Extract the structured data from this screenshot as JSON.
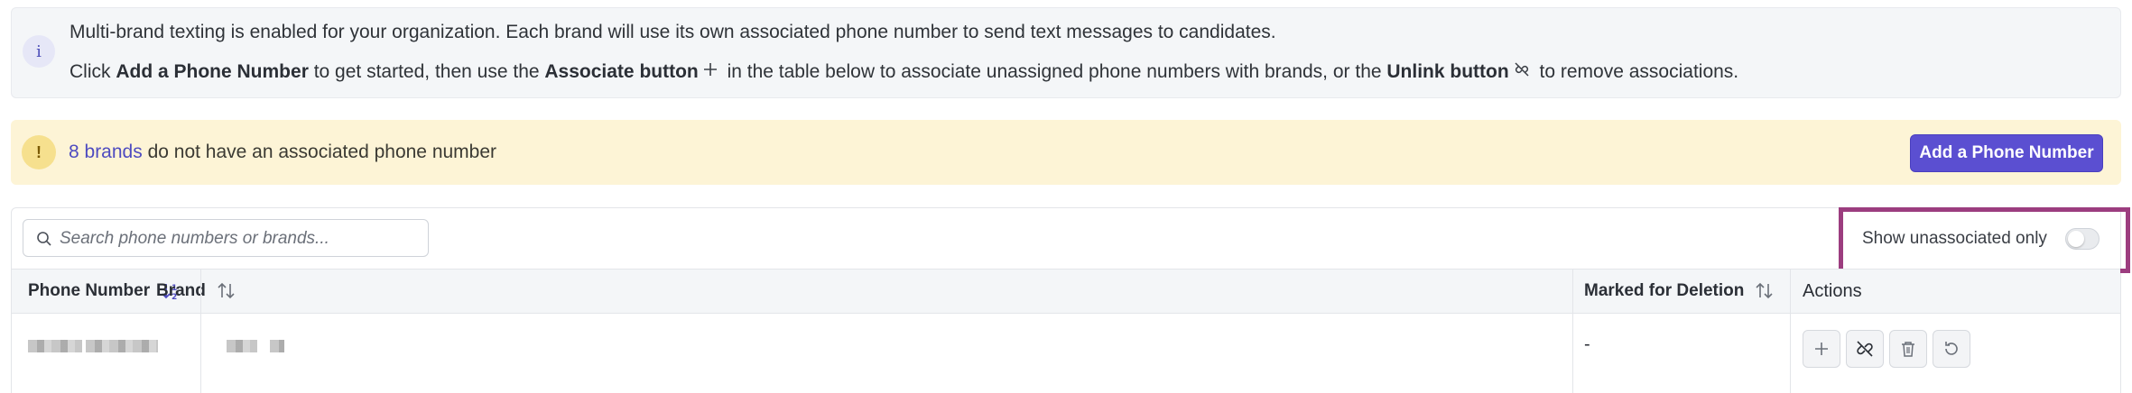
{
  "info_banner": {
    "icon": "info-icon",
    "icon_glyph": "i",
    "line1": "Multi-brand texting is enabled for your organization. Each brand will use its own associated phone number to send text messages to candidates.",
    "line2_part1": "Click ",
    "line2_bold1": "Add a Phone Number",
    "line2_part2": " to get started, then use the ",
    "line2_bold2": "Associate button",
    "line2_part3": " in the table below to associate unassigned phone numbers with brands, or the ",
    "line2_bold3": "Unlink button",
    "line2_part4": " to remove associations."
  },
  "warning_banner": {
    "icon_glyph": "!",
    "link_text": "8 brands",
    "text": " do not have an associated phone number",
    "button_label": "Add a Phone Number"
  },
  "search": {
    "placeholder": "Search phone numbers or brands..."
  },
  "filter": {
    "toggle_label": "Show unassociated only",
    "toggle_on": false,
    "highlight_color": "#9c3d7f"
  },
  "table": {
    "columns": [
      {
        "label": "Phone Number",
        "sort": "ascending"
      },
      {
        "label": "Brand",
        "sort": "none"
      },
      {
        "label": "Marked for Deletion",
        "sort": "none"
      },
      {
        "label": "Actions"
      }
    ],
    "rows": [
      {
        "phone_number": "[redacted]",
        "brand": "[redacted]",
        "marked_for_deletion": "-",
        "actions": [
          "associate-icon",
          "unlink-icon",
          "trash-icon",
          "restore-icon"
        ]
      }
    ]
  },
  "colors": {
    "accent": "#5b4fd1",
    "info_bg": "#f4f6f8",
    "warning_bg": "#fdf4d6"
  }
}
